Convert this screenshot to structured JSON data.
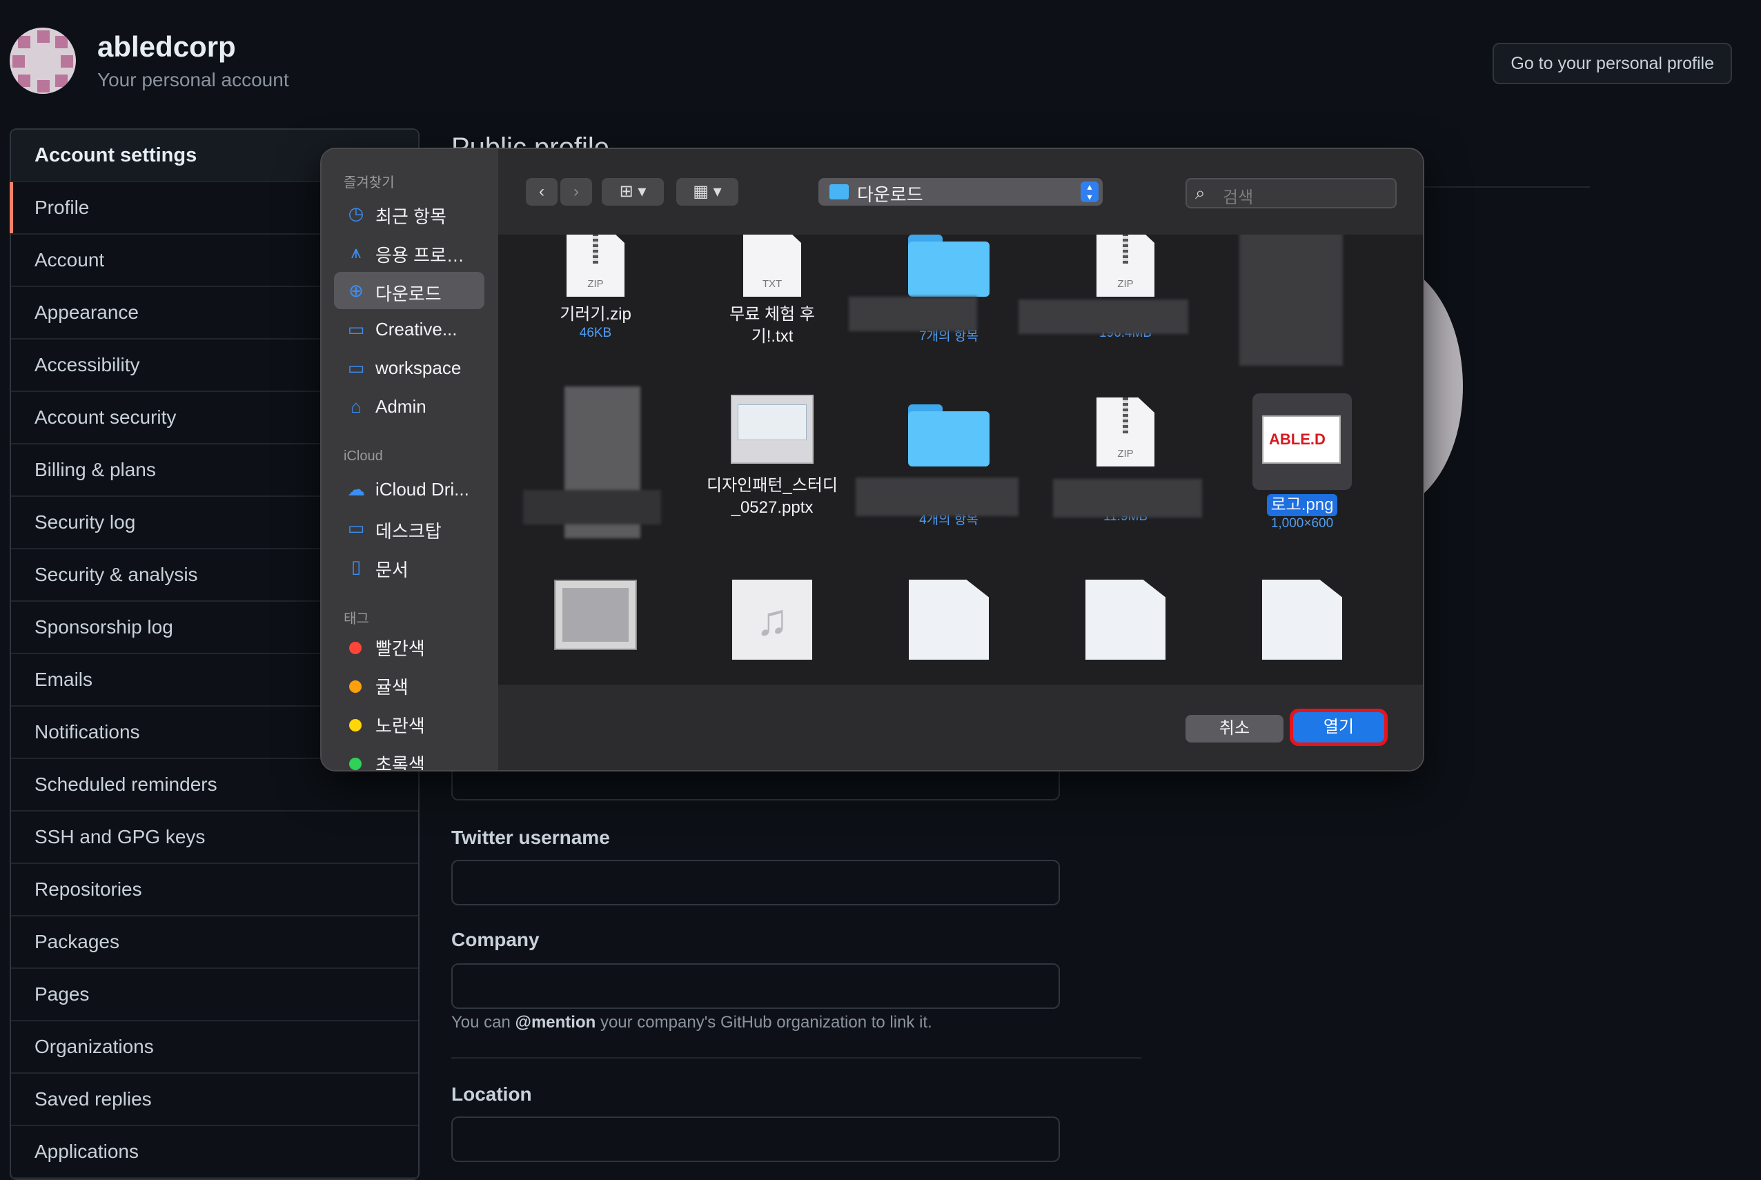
{
  "account": {
    "name": "abledcorp",
    "subtitle": "Your personal account",
    "profile_button": "Go to your personal profile"
  },
  "sidebar": {
    "heading": "Account settings",
    "items": [
      {
        "label": "Profile",
        "active": true
      },
      {
        "label": "Account"
      },
      {
        "label": "Appearance"
      },
      {
        "label": "Accessibility"
      },
      {
        "label": "Account security"
      },
      {
        "label": "Billing & plans"
      },
      {
        "label": "Security log"
      },
      {
        "label": "Security & analysis"
      },
      {
        "label": "Sponsorship log"
      },
      {
        "label": "Emails"
      },
      {
        "label": "Notifications"
      },
      {
        "label": "Scheduled reminders"
      },
      {
        "label": "SSH and GPG keys"
      },
      {
        "label": "Repositories"
      },
      {
        "label": "Packages"
      },
      {
        "label": "Pages"
      },
      {
        "label": "Organizations"
      },
      {
        "label": "Saved replies"
      },
      {
        "label": "Applications"
      }
    ]
  },
  "main": {
    "section_title": "Public profile",
    "fields": {
      "twitter_label": "Twitter username",
      "company_label": "Company",
      "company_note_prefix": "You can",
      "company_note_mention": "@mention",
      "company_note_suffix": "your company's GitHub organization to link it.",
      "location_label": "Location"
    }
  },
  "dialog": {
    "sidebar": {
      "favorites_title": "즐겨찾기",
      "favorites": [
        {
          "label": "최근 항목",
          "icon": "clock-icon"
        },
        {
          "label": "응용 프로…",
          "icon": "apps-icon"
        },
        {
          "label": "다운로드",
          "icon": "download-icon",
          "selected": true
        },
        {
          "label": "Creative...",
          "icon": "folder-icon"
        },
        {
          "label": "workspace",
          "icon": "folder-icon"
        },
        {
          "label": "Admin",
          "icon": "home-icon"
        }
      ],
      "icloud_title": "iCloud",
      "icloud": [
        {
          "label": "iCloud Dri...",
          "icon": "cloud-icon"
        },
        {
          "label": "데스크탑",
          "icon": "desktop-icon"
        },
        {
          "label": "문서",
          "icon": "document-icon"
        }
      ],
      "tags_title": "태그",
      "tags": [
        {
          "label": "빨간색",
          "color": "#ff453a"
        },
        {
          "label": "귤색",
          "color": "#ff9f0a"
        },
        {
          "label": "노란색",
          "color": "#ffd60a"
        },
        {
          "label": "초록색",
          "color": "#30d158"
        }
      ]
    },
    "toolbar": {
      "back": "‹",
      "forward": "›",
      "location": "다운로드",
      "search_placeholder": "검색"
    },
    "files": {
      "row1": [
        {
          "name": "기러기.zip",
          "meta": "46KB",
          "kind": "ZIP"
        },
        {
          "name": "무료 체험 후기!.txt",
          "meta": "",
          "kind": "TXT"
        },
        {
          "name": "",
          "meta": "7개의 항목",
          "kind": "folder"
        },
        {
          "name": "",
          "meta": "196.4MB",
          "kind": "ZIP"
        },
        {
          "name": "",
          "meta": "",
          "kind": "blurred"
        }
      ],
      "row2": [
        {
          "name": "",
          "meta": "",
          "kind": "blurred"
        },
        {
          "name": "디자인패턴_스터디_0527.pptx",
          "meta": "",
          "kind": "pptx"
        },
        {
          "name": "",
          "meta": "4개의 항목",
          "kind": "folder"
        },
        {
          "name": "",
          "meta": "11.9MB",
          "kind": "ZIP"
        },
        {
          "name": "로고.png",
          "meta": "1,000×600",
          "kind": "png",
          "selected": true,
          "logo_text": "ABLE.D"
        }
      ]
    },
    "footer": {
      "cancel": "취소",
      "open": "열기"
    }
  }
}
